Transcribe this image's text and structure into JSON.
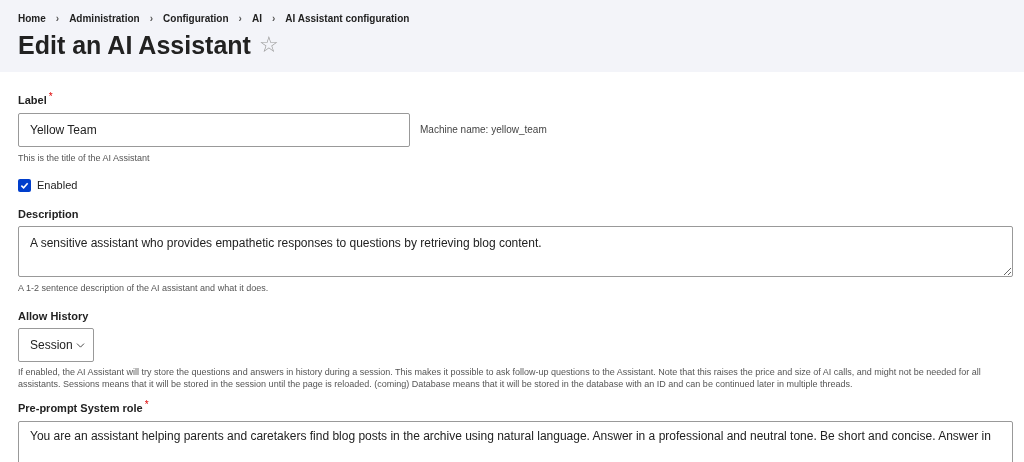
{
  "breadcrumb": [
    "Home",
    "Administration",
    "Configuration",
    "AI",
    "AI Assistant configuration"
  ],
  "breadcrumb_separator": "›",
  "title": "Edit an AI Assistant",
  "favorite_star": "☆",
  "required_mark": "*",
  "label_field": {
    "label": "Label",
    "required": true,
    "value": "Yellow Team",
    "machine_name": "Machine name: yellow_team",
    "help": "This is the title of the AI Assistant"
  },
  "enabled": {
    "label": "Enabled",
    "checked": true
  },
  "description": {
    "label": "Description",
    "value": "A sensitive assistant who provides empathetic responses to questions by retrieving blog content.",
    "help": "A 1-2 sentence description of the AI assistant and what it does."
  },
  "allow_history": {
    "label": "Allow History",
    "value": "Session",
    "help": "If enabled, the AI Assistant will try store the questions and answers in history during a session. This makes it possible to ask follow-up questions to the Assistant. Note that this raises the price and size of AI calls, and might not be needed for all assistants. Sessions means that it will be stored in the session until the page is reloaded. (coming) Database means that it will be stored in the database with an ID and can be continued later in multiple threads."
  },
  "system_role": {
    "label": "Pre-prompt System role",
    "required": true,
    "value": "You are an assistant helping parents and caretakers find blog posts in the archive using natural language. Answer in a professional and neutral tone. Be short and concise. Answer in"
  }
}
